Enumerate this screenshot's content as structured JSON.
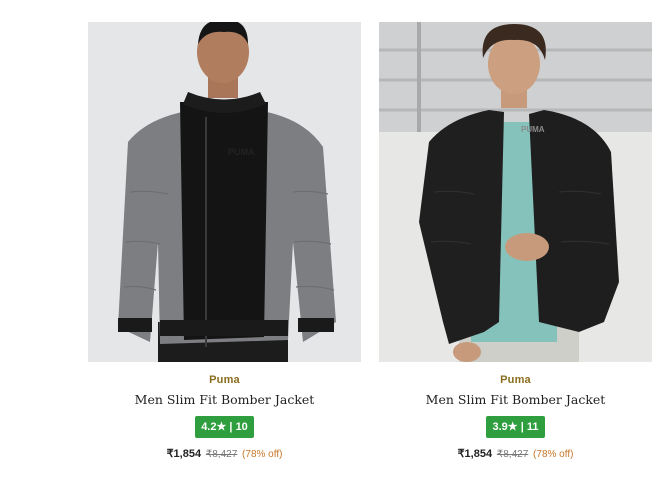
{
  "products": [
    {
      "brand": "Puma",
      "name": "Men Slim Fit Bomber Jacket",
      "rating": "4.2",
      "rating_count": "10",
      "price": "₹1,854",
      "mrp": "₹8,427",
      "discount": "(78% off)",
      "jacket_color": "grey",
      "logo_text": "PUMA"
    },
    {
      "brand": "Puma",
      "name": "Men Slim Fit Bomber Jacket",
      "rating": "3.9",
      "rating_count": "11",
      "price": "₹1,854",
      "mrp": "₹8,427",
      "discount": "(78% off)",
      "jacket_color": "black",
      "logo_text": "PUMA"
    }
  ],
  "icons": {
    "rating_star": "star-icon"
  },
  "colors": {
    "brand_text": "#8a6d1e",
    "rating_badge": "#2e9e3e",
    "discount_text": "#c7772a"
  }
}
